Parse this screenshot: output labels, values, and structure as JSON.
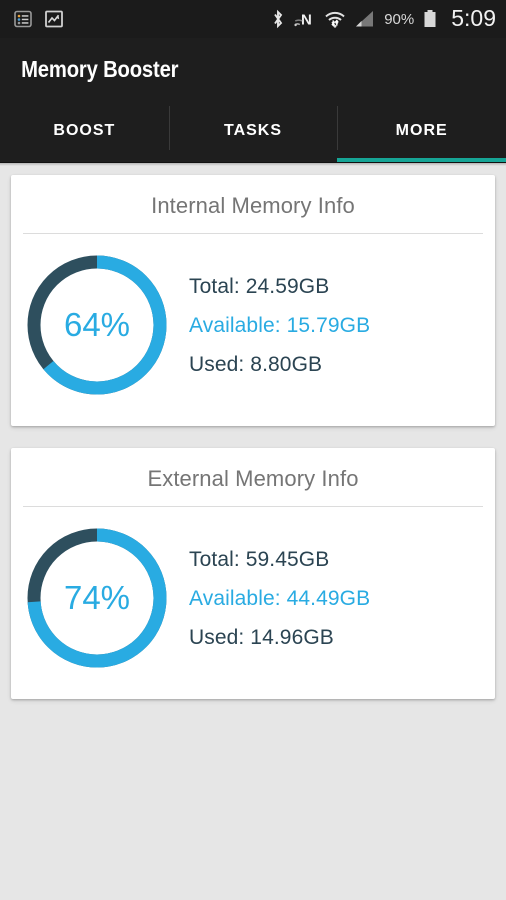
{
  "status_bar": {
    "notification_icons": [
      "list-notification-icon",
      "image-notification-icon"
    ],
    "system_icons": [
      "bluetooth-icon",
      "nfc-icon",
      "wifi-icon",
      "cellular-signal-icon"
    ],
    "battery_percent": "90%",
    "time": "5:09"
  },
  "app_bar": {
    "title": "Memory Booster"
  },
  "tabs": {
    "items": [
      {
        "label": "BOOST",
        "active": false
      },
      {
        "label": "TASKS",
        "active": false
      },
      {
        "label": "MORE",
        "active": true
      }
    ],
    "active_index": 2,
    "indicator_color": "#16a596"
  },
  "cards": [
    {
      "title": "Internal Memory Info",
      "percent_label": "64%",
      "percent_value": 64,
      "stats": [
        {
          "label": "Total: 24.59GB",
          "accent": false
        },
        {
          "label": "Available: 15.79GB",
          "accent": true
        },
        {
          "label": "Used: 8.80GB",
          "accent": false
        }
      ]
    },
    {
      "title": "External Memory Info",
      "percent_label": "74%",
      "percent_value": 74,
      "stats": [
        {
          "label": "Total: 59.45GB",
          "accent": false
        },
        {
          "label": "Available: 44.49GB",
          "accent": true
        },
        {
          "label": "Used: 14.96GB",
          "accent": false
        }
      ]
    }
  ],
  "colors": {
    "accent_blue": "#29abe2",
    "track_dark": "#2e4f5e",
    "text_dark": "#2b4452",
    "title_gray": "#757575",
    "page_background": "#e6e6e6",
    "chrome_dark": "#1e1e1e"
  }
}
